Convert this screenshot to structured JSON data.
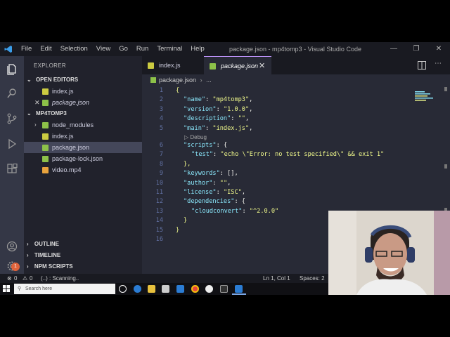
{
  "titlebar": {
    "menu": [
      "File",
      "Edit",
      "Selection",
      "View",
      "Go",
      "Run",
      "Terminal",
      "Help"
    ],
    "window_title": "package.json - mp4tomp3 - Visual Studio Code"
  },
  "activity_bar": {
    "icons": [
      "explorer-icon",
      "search-icon",
      "source-control-icon",
      "run-debug-icon",
      "extensions-icon",
      "account-icon",
      "settings-icon"
    ],
    "settings_badge": "1"
  },
  "sidebar": {
    "title": "EXPLORER",
    "open_editors": {
      "label": "OPEN EDITORS",
      "items": [
        {
          "name": "index.js",
          "icon": "js-file-icon",
          "color": "#cbcb41"
        },
        {
          "name": "package.json",
          "icon": "json-file-icon",
          "color": "#8dc149",
          "close": "✕"
        }
      ]
    },
    "project": {
      "label": "MP4TOMP3",
      "items": [
        {
          "name": "node_modules",
          "icon": "folder-icon",
          "color": "#8dc149",
          "chevron": "›"
        },
        {
          "name": "index.js",
          "icon": "js-file-icon",
          "color": "#cbcb41"
        },
        {
          "name": "package.json",
          "icon": "json-file-icon",
          "color": "#8dc149"
        },
        {
          "name": "package-lock.json",
          "icon": "json-file-icon",
          "color": "#8dc149"
        },
        {
          "name": "video.mp4",
          "icon": "video-file-icon",
          "color": "#e8a33d"
        }
      ]
    },
    "outline": "OUTLINE",
    "timeline": "TIMELINE",
    "npm_scripts": "NPM SCRIPTS"
  },
  "tabs": [
    {
      "label": "index.js",
      "icon": "js-file-icon",
      "color": "#cbcb41"
    },
    {
      "label": "package.json",
      "icon": "json-file-icon",
      "color": "#8dc149",
      "close": "✕"
    }
  ],
  "breadcrumb": {
    "file": "package.json",
    "more": "..."
  },
  "editor": {
    "codelens": "Debug",
    "lines": [
      {
        "n": "1",
        "code": "{"
      },
      {
        "n": "2",
        "key": "\"name\"",
        "val": "\"mp4tomp3\"",
        "end": ","
      },
      {
        "n": "3",
        "key": "\"version\"",
        "val": "\"1.0.0\"",
        "end": ","
      },
      {
        "n": "4",
        "key": "\"description\"",
        "val": "\"\"",
        "end": ","
      },
      {
        "n": "5",
        "key": "\"main\"",
        "val": "\"index.js\"",
        "end": ","
      },
      {
        "n": "6",
        "key": "\"scripts\"",
        "val": "{",
        "end": ""
      },
      {
        "n": "7",
        "key": "\"test\"",
        "val": "\"echo \\\"Error: no test specified\\\" && exit 1\"",
        "end": ""
      },
      {
        "n": "8",
        "code": "},"
      },
      {
        "n": "9",
        "key": "\"keywords\"",
        "val": "[]",
        "end": ","
      },
      {
        "n": "10",
        "key": "\"author\"",
        "val": "\"\"",
        "end": ","
      },
      {
        "n": "11",
        "key": "\"license\"",
        "val": "\"ISC\"",
        "end": ","
      },
      {
        "n": "12",
        "key": "\"dependencies\"",
        "val": "{",
        "end": ""
      },
      {
        "n": "13",
        "key": "\"cloudconvert\"",
        "val": "\"^2.0.0\"",
        "end": ""
      },
      {
        "n": "14",
        "code": "}"
      },
      {
        "n": "15",
        "code": "}"
      },
      {
        "n": "16",
        "code": ""
      }
    ]
  },
  "status": {
    "errors": "0",
    "warnings": "0",
    "task": "(..) : Scanning..",
    "position": "Ln 1, Col 1",
    "spaces": "Spaces: 2"
  },
  "taskbar": {
    "search_placeholder": "Search here",
    "icons": [
      "windows-start-icon",
      "cortana-icon",
      "edge-icon",
      "file-explorer-icon",
      "store-icon",
      "mail-icon",
      "chrome-icon",
      "github-icon",
      "terminal-icon",
      "vscode-icon"
    ]
  },
  "colors": {
    "accent": "#bd93f9",
    "editor_bg": "#282a36",
    "sidebar_bg": "#21222c",
    "key": "#8be9fd",
    "string": "#f1fa8c"
  }
}
